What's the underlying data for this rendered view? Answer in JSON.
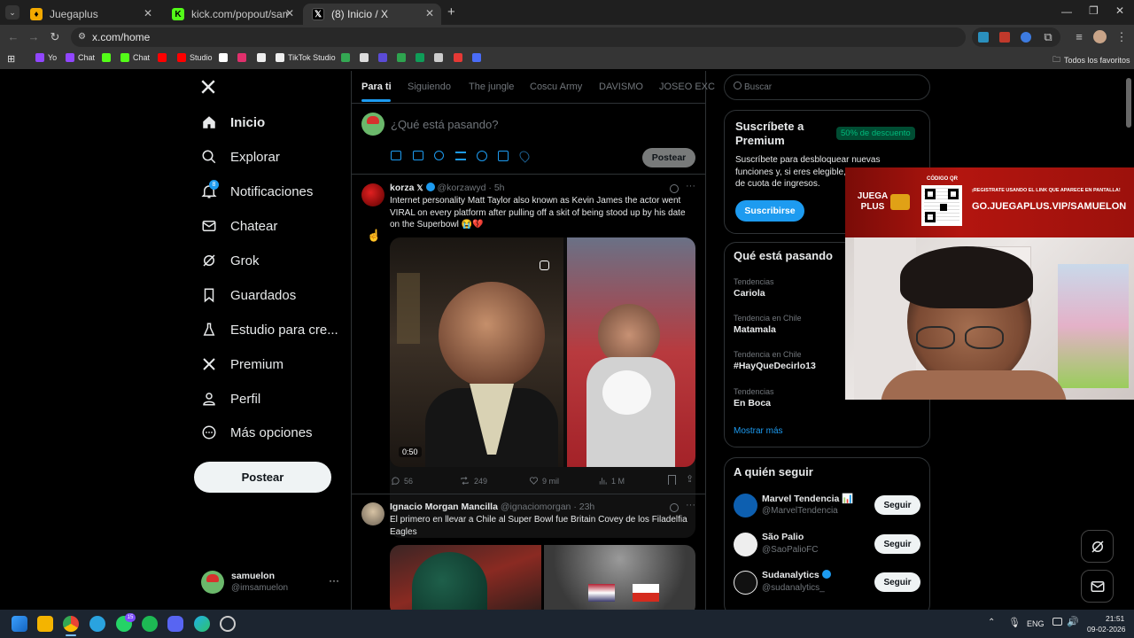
{
  "browser": {
    "tabs": [
      {
        "title": "Juegaplus",
        "active": false
      },
      {
        "title": "kick.com/popout/samuelon/ch",
        "active": false
      },
      {
        "title": "(8) Inicio / X",
        "active": true
      }
    ],
    "url": "x.com/home",
    "bookmarks": [
      "Yo",
      "Chat",
      "Chat",
      "Studio",
      "TikTok Studio"
    ],
    "bookmarks_folder": "Todos los favoritos"
  },
  "sidebar": {
    "nav": [
      {
        "label": "Inicio",
        "icon": "home-icon"
      },
      {
        "label": "Explorar",
        "icon": "search-icon"
      },
      {
        "label": "Notificaciones",
        "icon": "bell-icon",
        "badge": "8"
      },
      {
        "label": "Chatear",
        "icon": "mail-icon"
      },
      {
        "label": "Grok",
        "icon": "grok-icon"
      },
      {
        "label": "Guardados",
        "icon": "bookmark-icon"
      },
      {
        "label": "Estudio para cre...",
        "icon": "flask-icon"
      },
      {
        "label": "Premium",
        "icon": "x-logo-icon"
      },
      {
        "label": "Perfil",
        "icon": "person-icon"
      },
      {
        "label": "Más opciones",
        "icon": "more-circle-icon"
      }
    ],
    "post_button": "Postear",
    "account": {
      "name": "samuelon",
      "handle": "@imsamuelon"
    }
  },
  "feed": {
    "tabs": [
      "Para ti",
      "Siguiendo",
      "The jungle",
      "Coscu Army",
      "DAVISMO",
      "JOSEO EXC"
    ],
    "composer_placeholder": "¿Qué está pasando?",
    "composer_post": "Postear",
    "tweets": [
      {
        "name": "korza",
        "handle": "@korzawyd",
        "time": "5h",
        "text": "Internet personality Matt Taylor also known as Kevin James the actor went VIRAL on every platform after pulling off a skit of being stood up by his date on the Superbowl 😭💔",
        "video_time": "0:50",
        "replies": "56",
        "reposts": "249",
        "likes": "9 mil",
        "views": "1 M"
      },
      {
        "name": "Ignacio Morgan Mancilla",
        "handle": "@ignaciomorgan",
        "time": "23h",
        "text": "El primero en llevar a Chile al Super Bowl fue Britain Covey de los Filadelfia Eagles"
      }
    ]
  },
  "right": {
    "search_placeholder": "Buscar",
    "premium": {
      "title": "Suscríbete a Premium",
      "badge": "50% de descuento",
      "body": "Suscríbete para desbloquear nuevas funciones y, si eres elegible, recibir una parte de cuota de ingresos.",
      "button": "Suscribirse"
    },
    "trends_title": "Qué está pasando",
    "trends": [
      {
        "category": "Tendencias",
        "name": "Cariola"
      },
      {
        "category": "Tendencia en Chile",
        "name": "Matamala"
      },
      {
        "category": "Tendencia en Chile",
        "name": "#HayQueDecirlo13"
      },
      {
        "category": "Tendencias",
        "name": "En Boca"
      }
    ],
    "show_more": "Mostrar más",
    "follow_title": "A quién seguir",
    "follow": [
      {
        "name": "Marvel Tendencia 📊",
        "handle": "@MarvelTendencia",
        "button": "Seguir"
      },
      {
        "name": "São Palio",
        "handle": "@SaoPalioFC",
        "button": "Seguir"
      },
      {
        "name": "Sudanalytics",
        "handle": "@sudanalytics_",
        "button": "Seguir"
      }
    ]
  },
  "overlay": {
    "brand": "JUEGA PLUS",
    "code_label": "CÓDIGO QR",
    "promo": "¡REGÍSTRATE USANDO EL LINK QUE APARECE EN PANTALLA!",
    "url": "GO.JUEGAPLUS.VIP/SAMUELON"
  },
  "taskbar": {
    "lang": "ENG",
    "time": "21:51",
    "date": "09-02-2026",
    "whatsapp_badge": "15"
  },
  "colors": {
    "accent": "#1d9bf0",
    "premium_badge": "#00ba7c",
    "overlay_red": "#b3150f"
  }
}
